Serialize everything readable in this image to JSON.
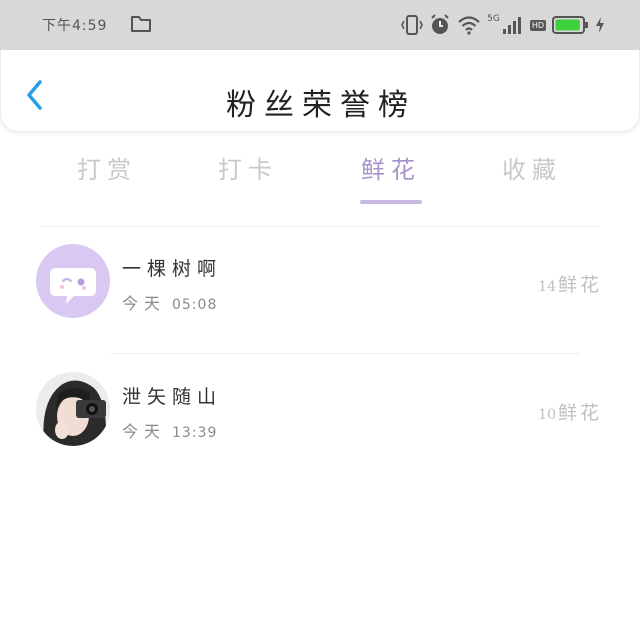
{
  "status_bar": {
    "time": "下午4:59",
    "network": "5G",
    "hd": "HD",
    "icons": [
      "folder-icon",
      "vibrate-icon",
      "alarm-icon",
      "wifi-icon",
      "signal-icon",
      "battery-icon"
    ],
    "battery_level": 0.9,
    "battery_color": "#3fcf3f"
  },
  "header": {
    "title": "粉丝荣誉榜",
    "back_icon": "chevron-left-icon",
    "back_color": "#2a9de8"
  },
  "tabs": [
    {
      "label": "打赏",
      "active": false
    },
    {
      "label": "打卡",
      "active": false
    },
    {
      "label": "鲜花",
      "active": true
    },
    {
      "label": "收藏",
      "active": false
    }
  ],
  "accent_color": "#a894c9",
  "fans": [
    {
      "name": "一棵树啊",
      "day": "今天",
      "time": "05:08",
      "count": "14",
      "unit": "鲜花",
      "avatar": "chat-bubble-avatar"
    },
    {
      "name": "泄矢随山",
      "day": "今天",
      "time": "13:39",
      "count": "10",
      "unit": "鲜花",
      "avatar": "photo-avatar"
    }
  ]
}
